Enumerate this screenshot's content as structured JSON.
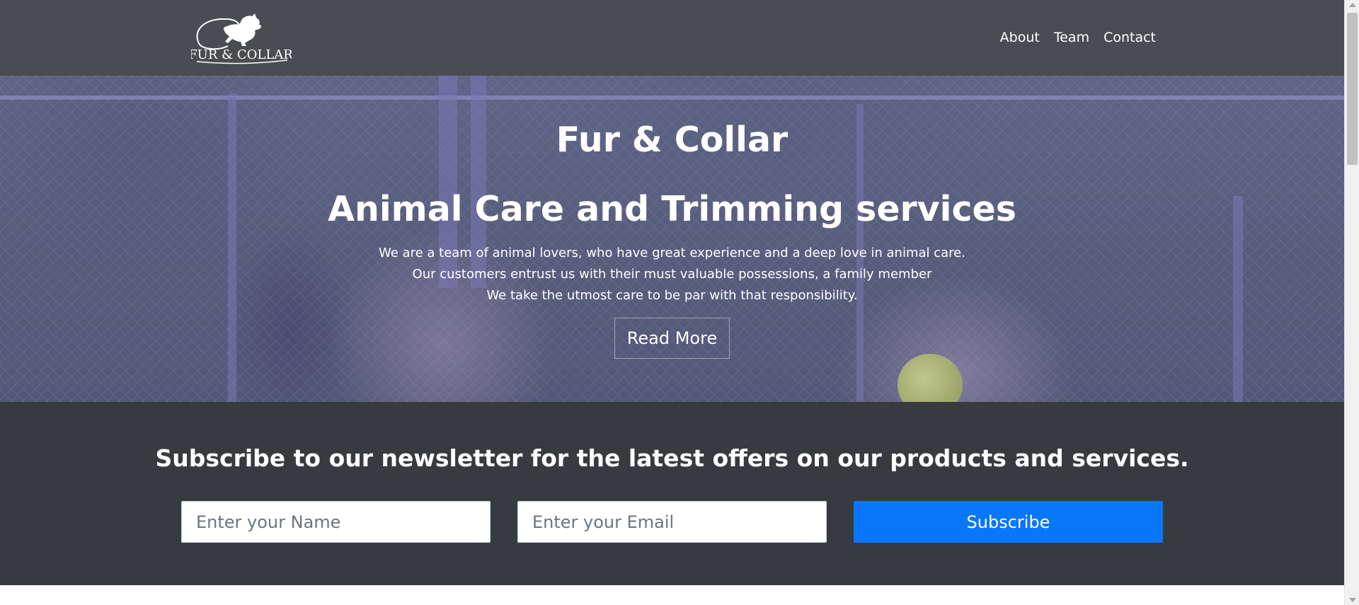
{
  "header": {
    "logo_text": "FUR & COLLAR",
    "nav": [
      {
        "label": "About"
      },
      {
        "label": "Team"
      },
      {
        "label": "Contact"
      }
    ]
  },
  "hero": {
    "brand": "Fur & Collar",
    "headline": "Animal Care and Trimming services",
    "lines": [
      "We are a team of animal lovers, who have great experience and a deep love in animal care.",
      "Our customers entrust us with their must valuable possessions, a family member",
      "We take the utmost care to be par with that responsibility."
    ],
    "cta_label": "Read More"
  },
  "newsletter": {
    "heading": "Subscribe to our newsletter for the latest offers on our products and services.",
    "name_placeholder": "Enter your Name",
    "email_placeholder": "Enter your Email",
    "subscribe_label": "Subscribe"
  },
  "colors": {
    "navbar_bg": "#494d52",
    "newsletter_bg": "#373b40",
    "primary_button": "#0a77fb",
    "hero_overlay": "#5658a0"
  },
  "icons": [
    "dog-logo-icon"
  ]
}
